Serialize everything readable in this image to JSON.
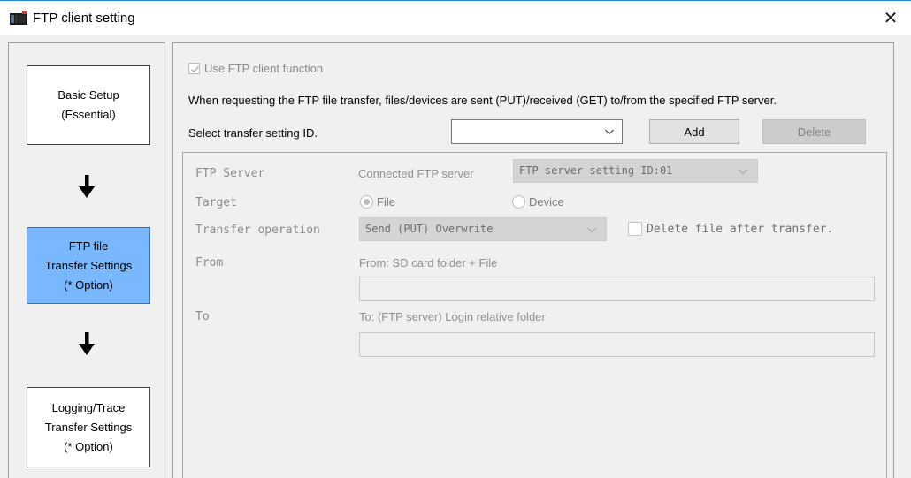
{
  "window": {
    "title": "FTP client setting",
    "close_glyph": "✕"
  },
  "steps": {
    "basic_setup": {
      "line1": "Basic Setup",
      "line2": "(Essential)"
    },
    "ftp_transfer": {
      "line1": "FTP file",
      "line2": "Transfer Settings",
      "line3": "(* Option)"
    },
    "logging": {
      "line1": "Logging/Trace",
      "line2": "Transfer Settings",
      "line3": "(* Option)"
    }
  },
  "main": {
    "use_ftp_label": "Use FTP client function",
    "use_ftp_checked": true,
    "description": "When requesting the FTP file transfer, files/devices are sent (PUT)/received (GET) to/from the specified FTP server.",
    "select_id_label": "Select transfer setting ID.",
    "select_id_value": "",
    "add_label": "Add",
    "delete_label": "Delete"
  },
  "settings": {
    "ftp_server_label": "FTP Server",
    "connected_label": "Connected FTP server",
    "connected_value": "FTP server setting ID:01",
    "target_label": "Target",
    "target_file": "File",
    "target_device": "Device",
    "target_selected": "File",
    "operation_label": "Transfer operation",
    "operation_value": "Send (PUT) Overwrite",
    "delete_after_label": "Delete file after transfer.",
    "delete_after_checked": false,
    "from_label": "From",
    "from_sub": "From: SD card folder + File",
    "from_value": "",
    "to_label": "To",
    "to_sub": "To: (FTP server) Login relative folder",
    "to_value": ""
  },
  "icons": {
    "app": "controller-icon",
    "down_arrow": "arrow-down-icon",
    "chevron": "chevron-down-icon",
    "check": "checkmark-icon"
  },
  "colors": {
    "active_step": "#79b8ff",
    "title_accent": "#1e88e5",
    "disabled_text": "#8c8c8c"
  }
}
